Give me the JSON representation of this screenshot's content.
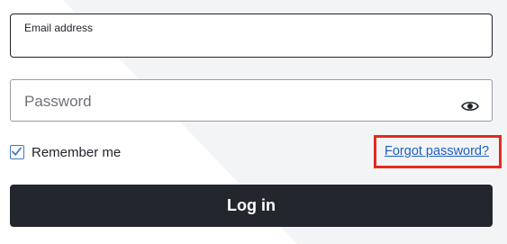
{
  "colors": {
    "background": "#ffffff",
    "background_shape": "#f3f4f6",
    "field_border_active": "#1f2229",
    "field_border": "#9a9da4",
    "checkbox_accent": "#3f78c9",
    "link": "#1d5fbf",
    "highlight_box": "#e42a1d",
    "button_background": "#24262d",
    "button_text": "#ffffff"
  },
  "form": {
    "email": {
      "label": "Email address",
      "value": ""
    },
    "password": {
      "placeholder": "Password",
      "value": "",
      "toggle_icon": "eye-icon"
    },
    "remember": {
      "label": "Remember me",
      "checked": true,
      "icon": "checkmark-icon"
    },
    "forgot_link": "Forgot password?",
    "login_label": "Log in"
  }
}
